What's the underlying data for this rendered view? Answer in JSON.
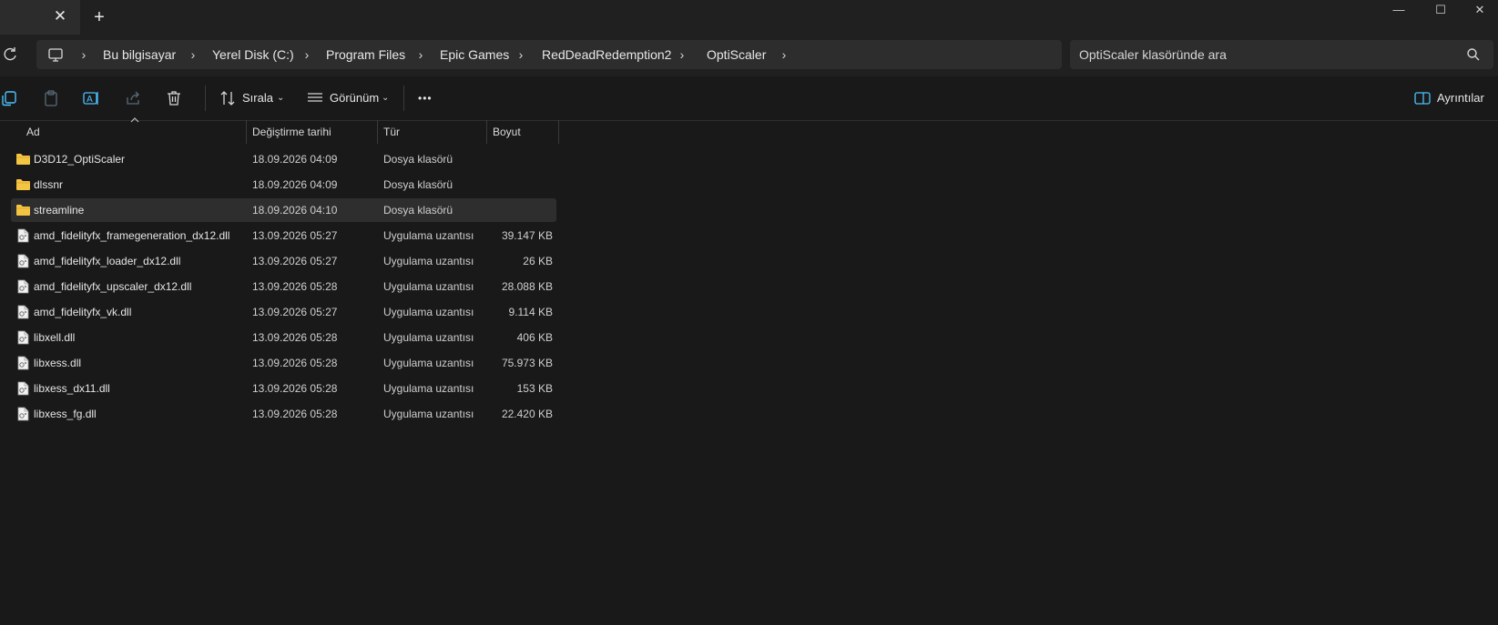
{
  "tab": {
    "close_glyph": "✕",
    "new_tab_glyph": "+"
  },
  "window_controls": {
    "minimize": "—",
    "maximize": "☐",
    "close": "✕"
  },
  "breadcrumb": [
    "Bu bilgisayar",
    "Yerel Disk (C:)",
    "Program Files",
    "Epic Games",
    "RedDeadRedemption2",
    "OptiScaler"
  ],
  "search": {
    "placeholder": "OptiScaler klasöründe ara"
  },
  "toolbar": {
    "sort_label": "Sırala",
    "view_label": "Görünüm",
    "more_label": "•••",
    "details_label": "Ayrıntılar"
  },
  "columns": {
    "name": "Ad",
    "date": "Değiştirme tarihi",
    "type": "Tür",
    "size": "Boyut"
  },
  "files": [
    {
      "name": "D3D12_OptiScaler",
      "date": "18.09.2026 04:09",
      "type": "Dosya klasörü",
      "size": "",
      "kind": "folder"
    },
    {
      "name": "dlssnr",
      "date": "18.09.2026 04:09",
      "type": "Dosya klasörü",
      "size": "",
      "kind": "folder"
    },
    {
      "name": "streamline",
      "date": "18.09.2026 04:10",
      "type": "Dosya klasörü",
      "size": "",
      "kind": "folder",
      "selected": true
    },
    {
      "name": "amd_fidelityfx_framegeneration_dx12.dll",
      "date": "13.09.2026 05:27",
      "type": "Uygulama uzantısı",
      "size": "39.147 KB",
      "kind": "dll"
    },
    {
      "name": "amd_fidelityfx_loader_dx12.dll",
      "date": "13.09.2026 05:27",
      "type": "Uygulama uzantısı",
      "size": "26 KB",
      "kind": "dll"
    },
    {
      "name": "amd_fidelityfx_upscaler_dx12.dll",
      "date": "13.09.2026 05:28",
      "type": "Uygulama uzantısı",
      "size": "28.088 KB",
      "kind": "dll"
    },
    {
      "name": "amd_fidelityfx_vk.dll",
      "date": "13.09.2026 05:27",
      "type": "Uygulama uzantısı",
      "size": "9.114 KB",
      "kind": "dll"
    },
    {
      "name": "libxell.dll",
      "date": "13.09.2026 05:28",
      "type": "Uygulama uzantısı",
      "size": "406 KB",
      "kind": "dll"
    },
    {
      "name": "libxess.dll",
      "date": "13.09.2026 05:28",
      "type": "Uygulama uzantısı",
      "size": "75.973 KB",
      "kind": "dll"
    },
    {
      "name": "libxess_dx11.dll",
      "date": "13.09.2026 05:28",
      "type": "Uygulama uzantısı",
      "size": "153 KB",
      "kind": "dll"
    },
    {
      "name": "libxess_fg.dll",
      "date": "13.09.2026 05:28",
      "type": "Uygulama uzantısı",
      "size": "22.420 KB",
      "kind": "dll"
    }
  ],
  "colors": {
    "accent": "#4cc2ff",
    "folder": "#f4c542",
    "selected_row": "#2e2e2e"
  }
}
